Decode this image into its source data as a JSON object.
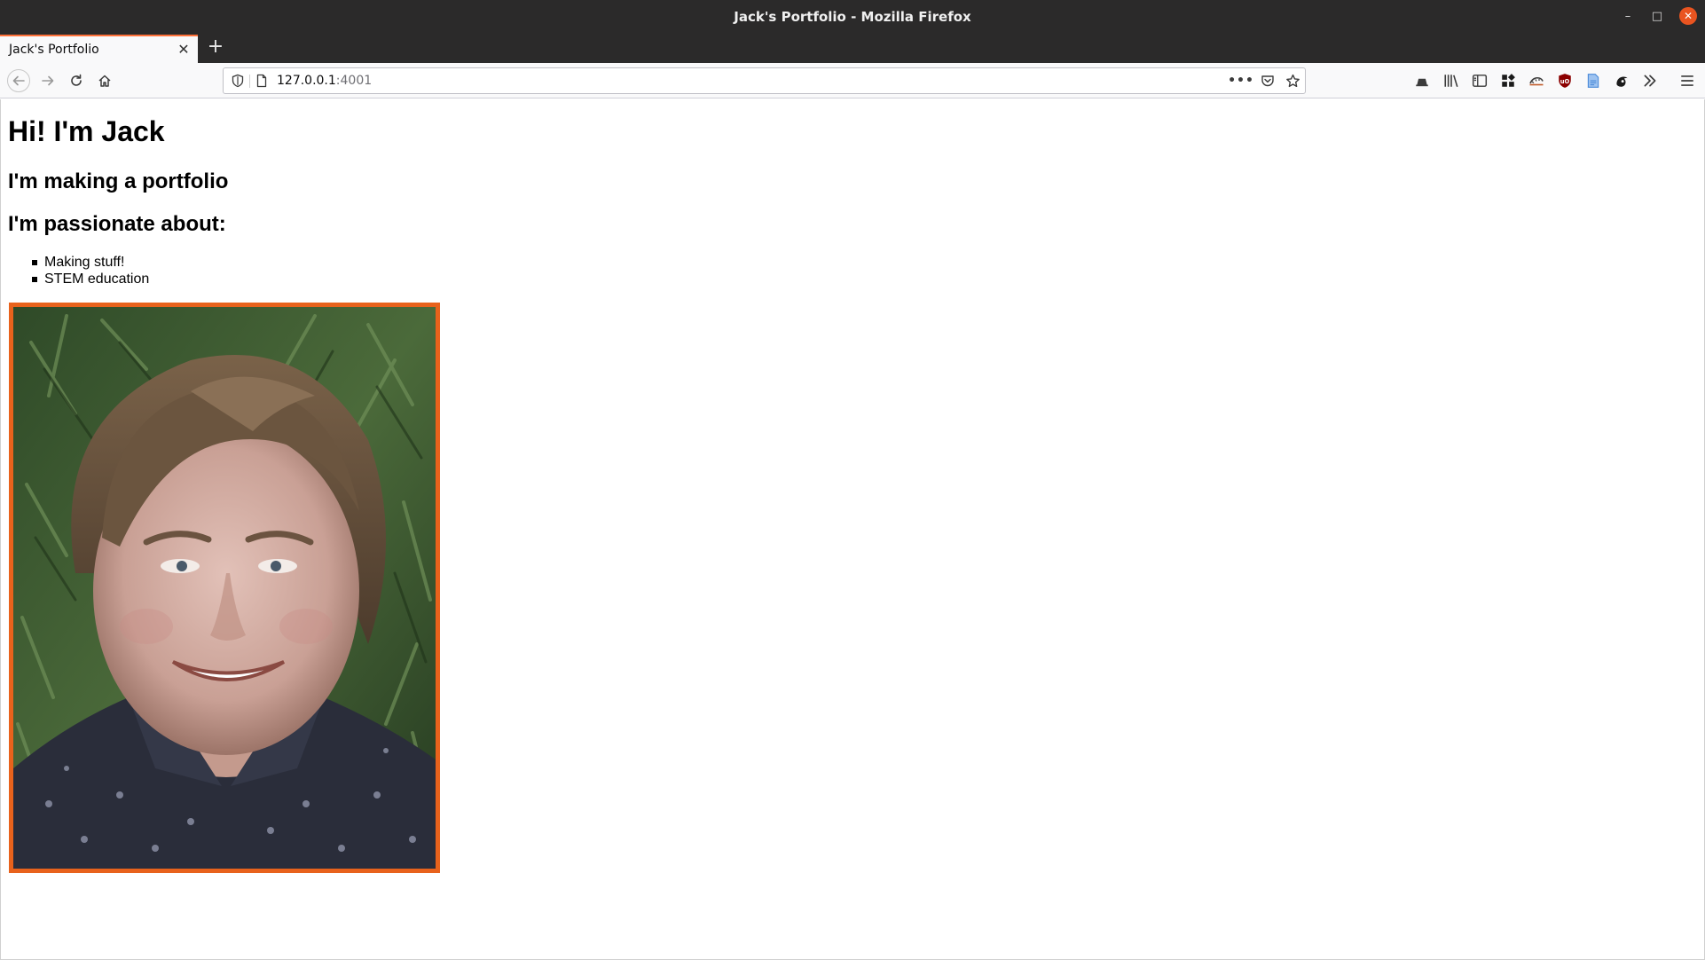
{
  "window": {
    "title": "Jack's Portfolio - Mozilla Firefox",
    "controls": {
      "minimize": "–",
      "maximize": "□",
      "close": "✕"
    }
  },
  "tabs": [
    {
      "label": "Jack's Portfolio",
      "active": true
    }
  ],
  "new_tab_label": "+",
  "navbar": {
    "url_host": "127.0.0.1",
    "url_port": ":4001",
    "more_label": "•••"
  },
  "page": {
    "heading": "Hi! I'm Jack",
    "subheading": "I'm making a portfolio",
    "passion_heading": "I'm passionate about:",
    "passions": [
      "Making stuff!",
      "STEM education"
    ],
    "photo_alt": "Photo of Jack"
  },
  "colors": {
    "accent": "#ff7139",
    "photo_border": "#e8621c",
    "close_button": "#e95420",
    "chrome": "#2b2a2a"
  },
  "icons": {
    "toolbar": [
      "container-icon",
      "library-icon",
      "sidebar-icon",
      "extensions-grid-icon",
      "cloud-sync-icon",
      "ublock-icon",
      "reader-icon",
      "extension-icon",
      "overflow-chevron-icon",
      "hamburger-menu-icon"
    ]
  }
}
